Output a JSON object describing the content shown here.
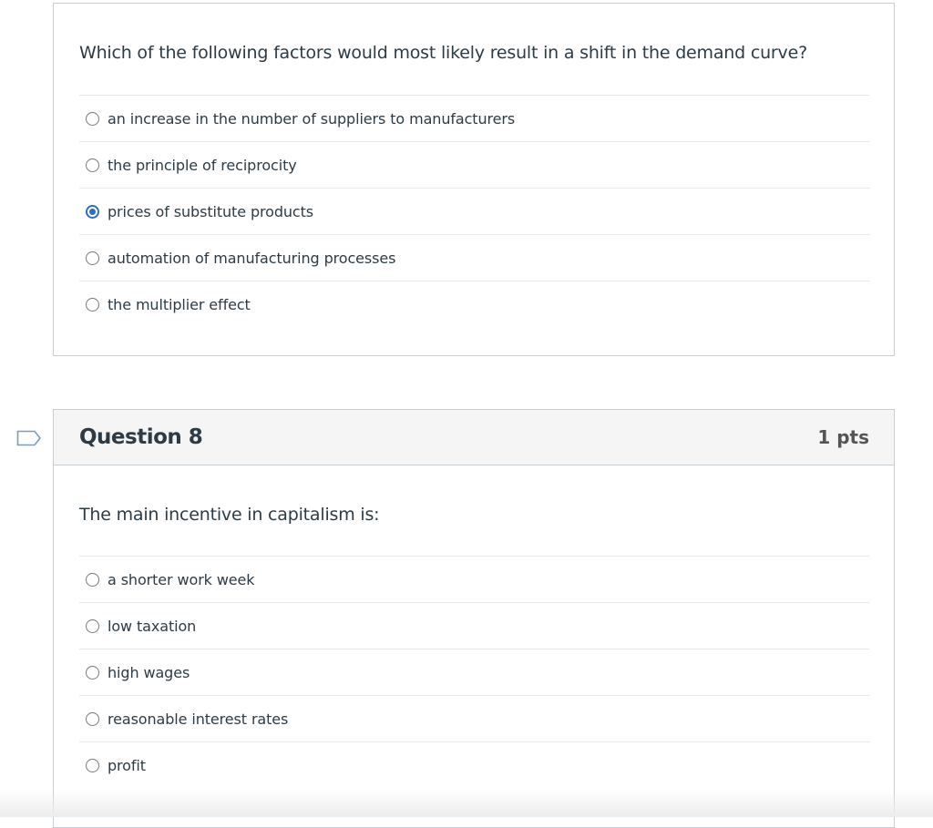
{
  "questions": [
    {
      "text": "Which of the following factors would most likely result in a shift in the demand curve?",
      "answers": [
        {
          "label": "an increase in the number of suppliers to manufacturers",
          "selected": false
        },
        {
          "label": "the principle of reciprocity",
          "selected": false
        },
        {
          "label": "prices of substitute products",
          "selected": true
        },
        {
          "label": "automation of manufacturing processes",
          "selected": false
        },
        {
          "label": "the multiplier effect",
          "selected": false
        }
      ]
    },
    {
      "title": "Question 8",
      "points": "1 pts",
      "flag_icon": "flag-outline-icon",
      "text": "The main incentive in capitalism is:",
      "answers": [
        {
          "label": "a shorter work week",
          "selected": false
        },
        {
          "label": "low taxation",
          "selected": false
        },
        {
          "label": "high wages",
          "selected": false
        },
        {
          "label": "reasonable interest rates",
          "selected": false
        },
        {
          "label": "profit",
          "selected": false
        }
      ]
    }
  ],
  "colors": {
    "accent": "#2b6cd3",
    "text": "#2d3b45",
    "border": "#c7cdd1",
    "header_bg": "#f5f5f5"
  }
}
